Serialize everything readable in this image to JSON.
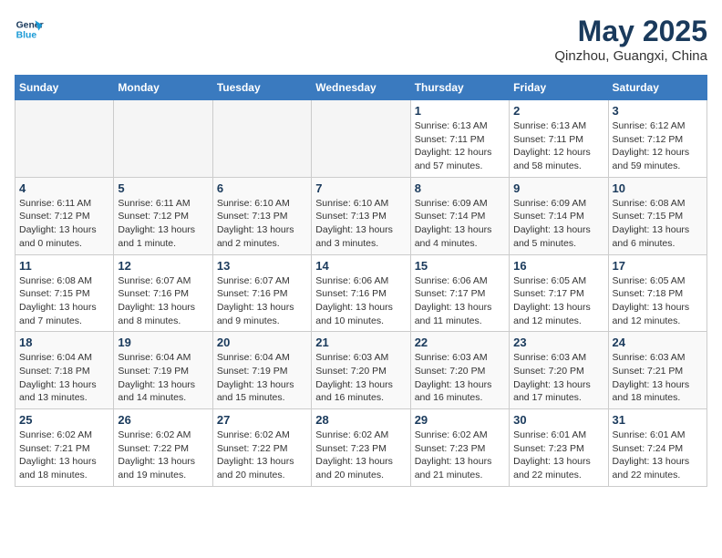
{
  "header": {
    "logo_general": "General",
    "logo_blue": "Blue",
    "month_year": "May 2025",
    "location": "Qinzhou, Guangxi, China"
  },
  "days_of_week": [
    "Sunday",
    "Monday",
    "Tuesday",
    "Wednesday",
    "Thursday",
    "Friday",
    "Saturday"
  ],
  "weeks": [
    [
      {
        "day": "",
        "info": ""
      },
      {
        "day": "",
        "info": ""
      },
      {
        "day": "",
        "info": ""
      },
      {
        "day": "",
        "info": ""
      },
      {
        "day": "1",
        "info": "Sunrise: 6:13 AM\nSunset: 7:11 PM\nDaylight: 12 hours\nand 57 minutes."
      },
      {
        "day": "2",
        "info": "Sunrise: 6:13 AM\nSunset: 7:11 PM\nDaylight: 12 hours\nand 58 minutes."
      },
      {
        "day": "3",
        "info": "Sunrise: 6:12 AM\nSunset: 7:12 PM\nDaylight: 12 hours\nand 59 minutes."
      }
    ],
    [
      {
        "day": "4",
        "info": "Sunrise: 6:11 AM\nSunset: 7:12 PM\nDaylight: 13 hours\nand 0 minutes."
      },
      {
        "day": "5",
        "info": "Sunrise: 6:11 AM\nSunset: 7:12 PM\nDaylight: 13 hours\nand 1 minute."
      },
      {
        "day": "6",
        "info": "Sunrise: 6:10 AM\nSunset: 7:13 PM\nDaylight: 13 hours\nand 2 minutes."
      },
      {
        "day": "7",
        "info": "Sunrise: 6:10 AM\nSunset: 7:13 PM\nDaylight: 13 hours\nand 3 minutes."
      },
      {
        "day": "8",
        "info": "Sunrise: 6:09 AM\nSunset: 7:14 PM\nDaylight: 13 hours\nand 4 minutes."
      },
      {
        "day": "9",
        "info": "Sunrise: 6:09 AM\nSunset: 7:14 PM\nDaylight: 13 hours\nand 5 minutes."
      },
      {
        "day": "10",
        "info": "Sunrise: 6:08 AM\nSunset: 7:15 PM\nDaylight: 13 hours\nand 6 minutes."
      }
    ],
    [
      {
        "day": "11",
        "info": "Sunrise: 6:08 AM\nSunset: 7:15 PM\nDaylight: 13 hours\nand 7 minutes."
      },
      {
        "day": "12",
        "info": "Sunrise: 6:07 AM\nSunset: 7:16 PM\nDaylight: 13 hours\nand 8 minutes."
      },
      {
        "day": "13",
        "info": "Sunrise: 6:07 AM\nSunset: 7:16 PM\nDaylight: 13 hours\nand 9 minutes."
      },
      {
        "day": "14",
        "info": "Sunrise: 6:06 AM\nSunset: 7:16 PM\nDaylight: 13 hours\nand 10 minutes."
      },
      {
        "day": "15",
        "info": "Sunrise: 6:06 AM\nSunset: 7:17 PM\nDaylight: 13 hours\nand 11 minutes."
      },
      {
        "day": "16",
        "info": "Sunrise: 6:05 AM\nSunset: 7:17 PM\nDaylight: 13 hours\nand 12 minutes."
      },
      {
        "day": "17",
        "info": "Sunrise: 6:05 AM\nSunset: 7:18 PM\nDaylight: 13 hours\nand 12 minutes."
      }
    ],
    [
      {
        "day": "18",
        "info": "Sunrise: 6:04 AM\nSunset: 7:18 PM\nDaylight: 13 hours\nand 13 minutes."
      },
      {
        "day": "19",
        "info": "Sunrise: 6:04 AM\nSunset: 7:19 PM\nDaylight: 13 hours\nand 14 minutes."
      },
      {
        "day": "20",
        "info": "Sunrise: 6:04 AM\nSunset: 7:19 PM\nDaylight: 13 hours\nand 15 minutes."
      },
      {
        "day": "21",
        "info": "Sunrise: 6:03 AM\nSunset: 7:20 PM\nDaylight: 13 hours\nand 16 minutes."
      },
      {
        "day": "22",
        "info": "Sunrise: 6:03 AM\nSunset: 7:20 PM\nDaylight: 13 hours\nand 16 minutes."
      },
      {
        "day": "23",
        "info": "Sunrise: 6:03 AM\nSunset: 7:20 PM\nDaylight: 13 hours\nand 17 minutes."
      },
      {
        "day": "24",
        "info": "Sunrise: 6:03 AM\nSunset: 7:21 PM\nDaylight: 13 hours\nand 18 minutes."
      }
    ],
    [
      {
        "day": "25",
        "info": "Sunrise: 6:02 AM\nSunset: 7:21 PM\nDaylight: 13 hours\nand 18 minutes."
      },
      {
        "day": "26",
        "info": "Sunrise: 6:02 AM\nSunset: 7:22 PM\nDaylight: 13 hours\nand 19 minutes."
      },
      {
        "day": "27",
        "info": "Sunrise: 6:02 AM\nSunset: 7:22 PM\nDaylight: 13 hours\nand 20 minutes."
      },
      {
        "day": "28",
        "info": "Sunrise: 6:02 AM\nSunset: 7:23 PM\nDaylight: 13 hours\nand 20 minutes."
      },
      {
        "day": "29",
        "info": "Sunrise: 6:02 AM\nSunset: 7:23 PM\nDaylight: 13 hours\nand 21 minutes."
      },
      {
        "day": "30",
        "info": "Sunrise: 6:01 AM\nSunset: 7:23 PM\nDaylight: 13 hours\nand 22 minutes."
      },
      {
        "day": "31",
        "info": "Sunrise: 6:01 AM\nSunset: 7:24 PM\nDaylight: 13 hours\nand 22 minutes."
      }
    ]
  ]
}
